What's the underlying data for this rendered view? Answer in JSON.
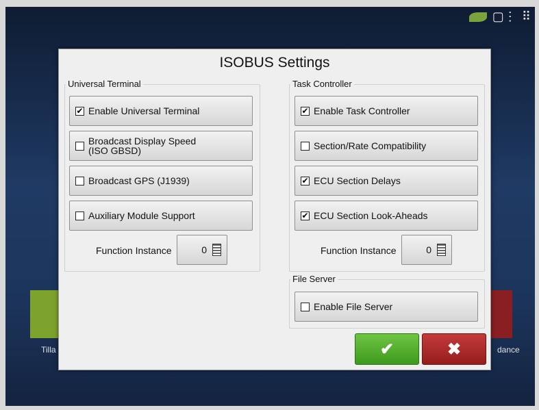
{
  "dialog": {
    "title": "ISOBUS Settings",
    "universal_terminal": {
      "label": "Universal Terminal",
      "options": [
        {
          "text": "Enable Universal Terminal",
          "checked": true
        },
        {
          "text": "Broadcast Display Speed\n(ISO GBSD)",
          "checked": false
        },
        {
          "text": "Broadcast GPS (J1939)",
          "checked": false
        },
        {
          "text": "Auxiliary Module Support",
          "checked": false
        }
      ],
      "function_instance_label": "Function Instance",
      "function_instance_value": "0"
    },
    "task_controller": {
      "label": "Task Controller",
      "options": [
        {
          "text": "Enable Task Controller",
          "checked": true
        },
        {
          "text": "Section/Rate Compatibility",
          "checked": false
        },
        {
          "text": "ECU Section Delays",
          "checked": true
        },
        {
          "text": "ECU Section Look-Aheads",
          "checked": true
        }
      ],
      "function_instance_label": "Function Instance",
      "function_instance_value": "0"
    },
    "file_server": {
      "label": "File Server",
      "option": {
        "text": "Enable File Server",
        "checked": false
      }
    },
    "ok_symbol": "✔",
    "cancel_symbol": "✖"
  },
  "background": {
    "left_tile_label": "Tilla",
    "right_tile_label": "dance"
  },
  "check_mark": "✔"
}
